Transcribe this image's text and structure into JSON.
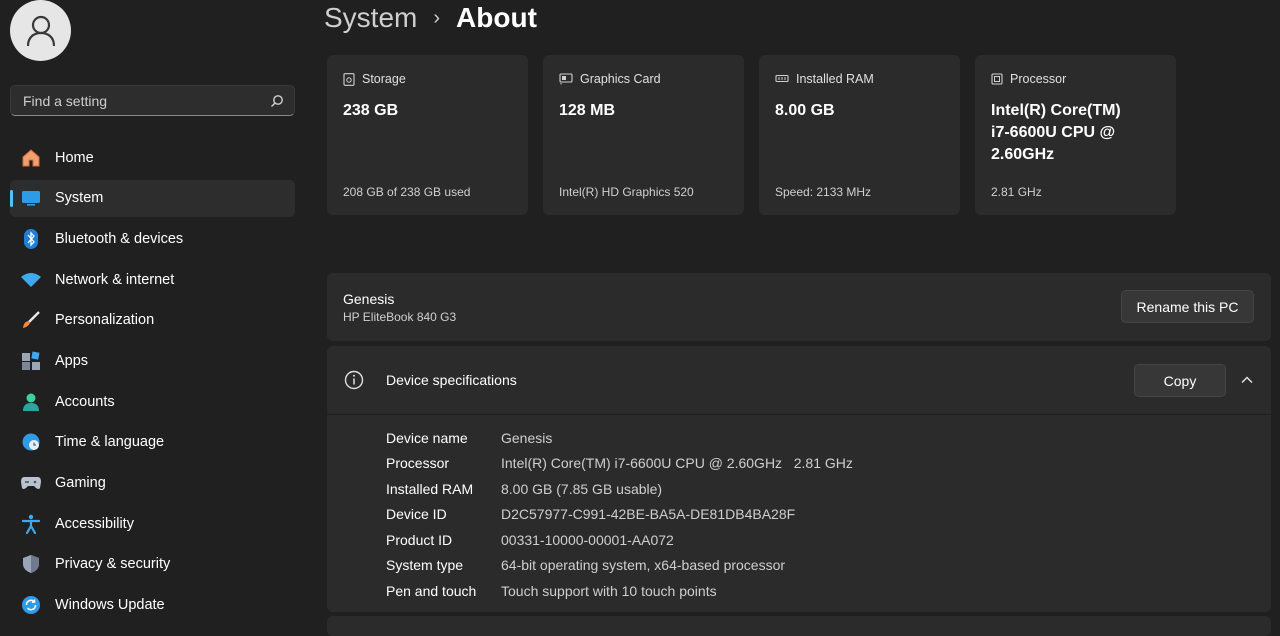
{
  "search": {
    "placeholder": "Find a setting"
  },
  "sidebar": {
    "items": [
      {
        "label": "Home",
        "icon": "home-icon",
        "active": false
      },
      {
        "label": "System",
        "icon": "system-icon",
        "active": true
      },
      {
        "label": "Bluetooth & devices",
        "icon": "bluetooth-icon",
        "active": false
      },
      {
        "label": "Network & internet",
        "icon": "wifi-icon",
        "active": false
      },
      {
        "label": "Personalization",
        "icon": "brush-icon",
        "active": false
      },
      {
        "label": "Apps",
        "icon": "apps-icon",
        "active": false
      },
      {
        "label": "Accounts",
        "icon": "accounts-icon",
        "active": false
      },
      {
        "label": "Time & language",
        "icon": "globe-clock-icon",
        "active": false
      },
      {
        "label": "Gaming",
        "icon": "gamepad-icon",
        "active": false
      },
      {
        "label": "Accessibility",
        "icon": "accessibility-icon",
        "active": false
      },
      {
        "label": "Privacy & security",
        "icon": "shield-icon",
        "active": false
      },
      {
        "label": "Windows Update",
        "icon": "update-icon",
        "active": false
      }
    ]
  },
  "breadcrumb": {
    "parent": "System",
    "separator": "›",
    "current": "About"
  },
  "cards": [
    {
      "title": "Storage",
      "icon": "storage-icon",
      "value": "238 GB",
      "sub": "208 GB of 238 GB used"
    },
    {
      "title": "Graphics Card",
      "icon": "graphics-card-icon",
      "value": "128 MB",
      "sub": "Intel(R) HD Graphics 520"
    },
    {
      "title": "Installed RAM",
      "icon": "ram-icon",
      "value": "8.00 GB",
      "sub": "Speed: 2133 MHz"
    },
    {
      "title": "Processor",
      "icon": "processor-icon",
      "value": "Intel(R) Core(TM) i7-6600U CPU @ 2.60GHz",
      "sub": "2.81 GHz"
    }
  ],
  "device": {
    "name": "Genesis",
    "model": "HP EliteBook 840 G3",
    "rename_label": "Rename this PC"
  },
  "specs": {
    "title": "Device specifications",
    "copy_label": "Copy",
    "rows": [
      {
        "label": "Device name",
        "value": "Genesis"
      },
      {
        "label": "Processor",
        "value": "Intel(R) Core(TM) i7-6600U CPU @ 2.60GHz   2.81 GHz"
      },
      {
        "label": "Installed RAM",
        "value": "8.00 GB (7.85 GB usable)"
      },
      {
        "label": "Device ID",
        "value": "D2C57977-C991-42BE-BA5A-DE81DB4BA28F"
      },
      {
        "label": "Product ID",
        "value": "00331-10000-00001-AA072"
      },
      {
        "label": "System type",
        "value": "64-bit operating system, x64-based processor"
      },
      {
        "label": "Pen and touch",
        "value": "Touch support with 10 touch points"
      }
    ]
  },
  "colors": {
    "accent": "#4cc2ff",
    "background": "#202020",
    "card": "#2b2b2b"
  }
}
